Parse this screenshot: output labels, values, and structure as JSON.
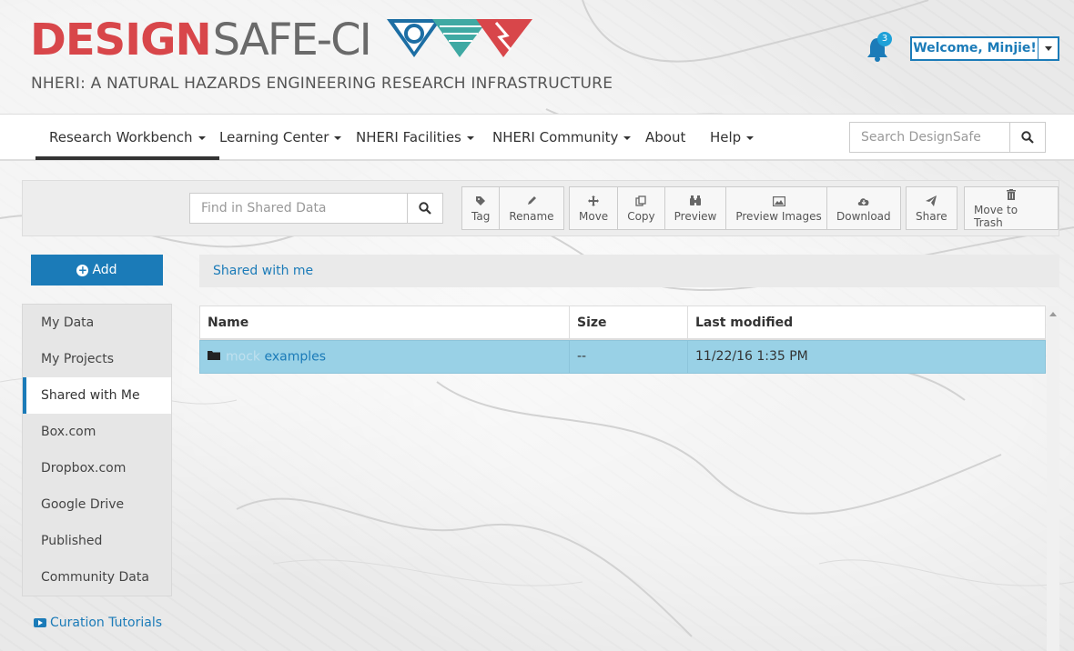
{
  "header": {
    "logo_design": "DESIGN",
    "logo_safe": "SAFE-CI",
    "tagline": "NHERI: A NATURAL HAZARDS ENGINEERING RESEARCH INFRASTRUCTURE",
    "notification_count": "3",
    "welcome_label": "Welcome, Minjie!"
  },
  "nav": {
    "items": [
      {
        "label": "Research Workbench",
        "has_caret": true,
        "active": true
      },
      {
        "label": "Learning Center",
        "has_caret": true
      },
      {
        "label": "NHERI Facilities",
        "has_caret": true
      },
      {
        "label": "NHERI Community",
        "has_caret": true
      },
      {
        "label": "About",
        "has_caret": false
      },
      {
        "label": "Help",
        "has_caret": true
      }
    ],
    "search_placeholder": "Search DesignSafe"
  },
  "toolbar": {
    "find_placeholder": "Find in Shared Data",
    "buttons": {
      "tag": "Tag",
      "rename": "Rename",
      "move": "Move",
      "copy": "Copy",
      "preview": "Preview",
      "preview_images": "Preview Images",
      "download": "Download",
      "share": "Share",
      "trash": "Move to Trash"
    }
  },
  "sidebar": {
    "add_label": "Add",
    "items": [
      {
        "label": "My Data"
      },
      {
        "label": "My Projects"
      },
      {
        "label": "Shared with Me",
        "active": true
      },
      {
        "label": "Box.com"
      },
      {
        "label": "Dropbox.com"
      },
      {
        "label": "Google Drive"
      },
      {
        "label": "Published"
      },
      {
        "label": "Community Data"
      }
    ],
    "tutorials_label": "Curation Tutorials"
  },
  "main": {
    "breadcrumb": "Shared with me",
    "columns": {
      "name": "Name",
      "size": "Size",
      "modified": "Last modified"
    },
    "rows": [
      {
        "name_prefix": "mock",
        "name": "examples",
        "size": "--",
        "modified": "11/22/16 1:35 PM"
      }
    ]
  },
  "colors": {
    "brand_red": "#d8464a",
    "brand_blue": "#1b7bb8",
    "selected_row": "#99d1e6"
  }
}
